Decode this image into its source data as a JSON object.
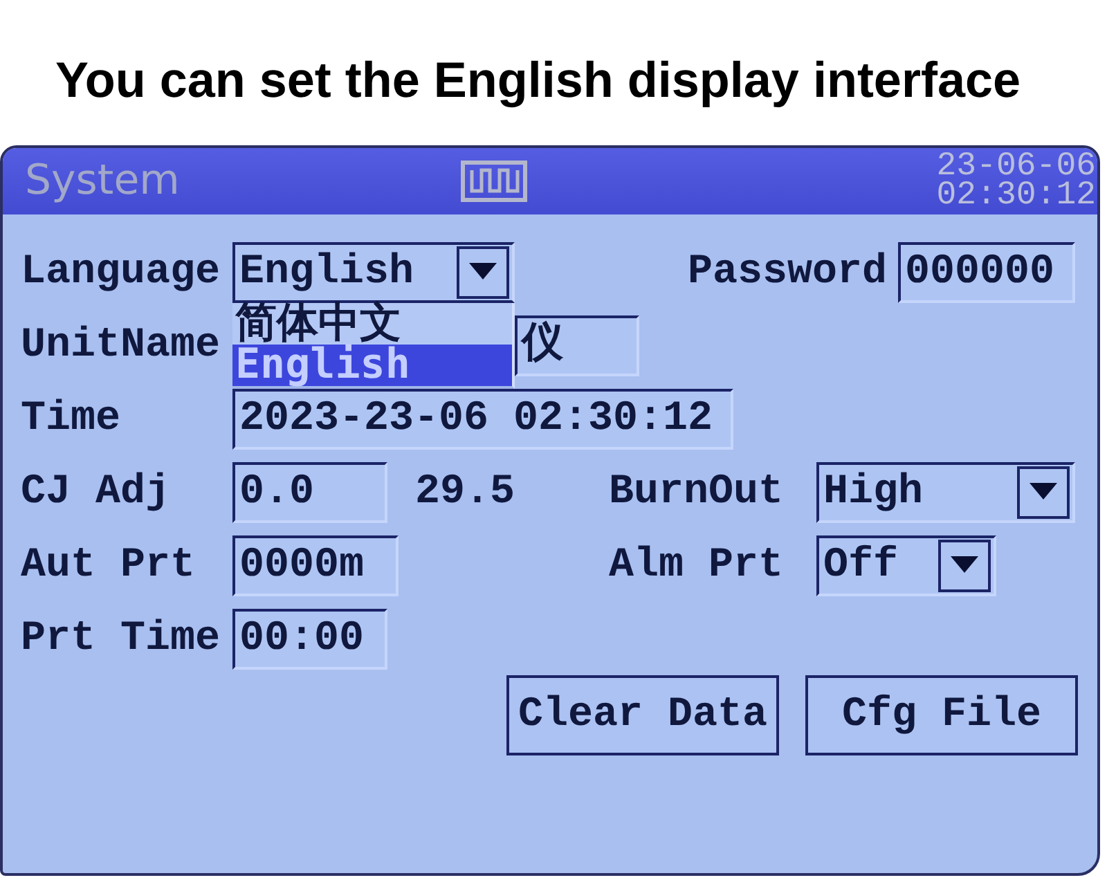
{
  "caption": {
    "text": "You can set the English display interface"
  },
  "window": {
    "title": "System",
    "date": "23-06-06",
    "time": "02:30:12"
  },
  "rows": [
    [
      {
        "kind": "dropdown",
        "label": "Language",
        "value": "English",
        "expanded": true,
        "options": [
          {
            "label": "简体中文",
            "selected": false
          },
          {
            "label": "English",
            "selected": true
          }
        ]
      },
      {
        "kind": "text",
        "label": "Password",
        "value": "000000"
      }
    ],
    [
      {
        "kind": "text",
        "label": "UnitName",
        "value": "仪"
      }
    ],
    [
      {
        "kind": "text",
        "label": "Time",
        "value": "2023-23-06 02:30:12"
      }
    ],
    [
      {
        "kind": "text",
        "label": "CJ Adj",
        "value": "0.0",
        "reading": "29.5"
      },
      {
        "kind": "dropdown",
        "label": "BurnOut",
        "value": "High",
        "expanded": false
      }
    ],
    [
      {
        "kind": "text",
        "label": "Aut Prt",
        "value": "0000m"
      },
      {
        "kind": "dropdown",
        "label": "Alm Prt",
        "value": "Off",
        "expanded": false
      }
    ],
    [
      {
        "kind": "text",
        "label": "Prt Time",
        "value": "00:00"
      }
    ]
  ],
  "buttons": [
    {
      "label": "Clear Data"
    },
    {
      "label": "Cfg File"
    }
  ]
}
